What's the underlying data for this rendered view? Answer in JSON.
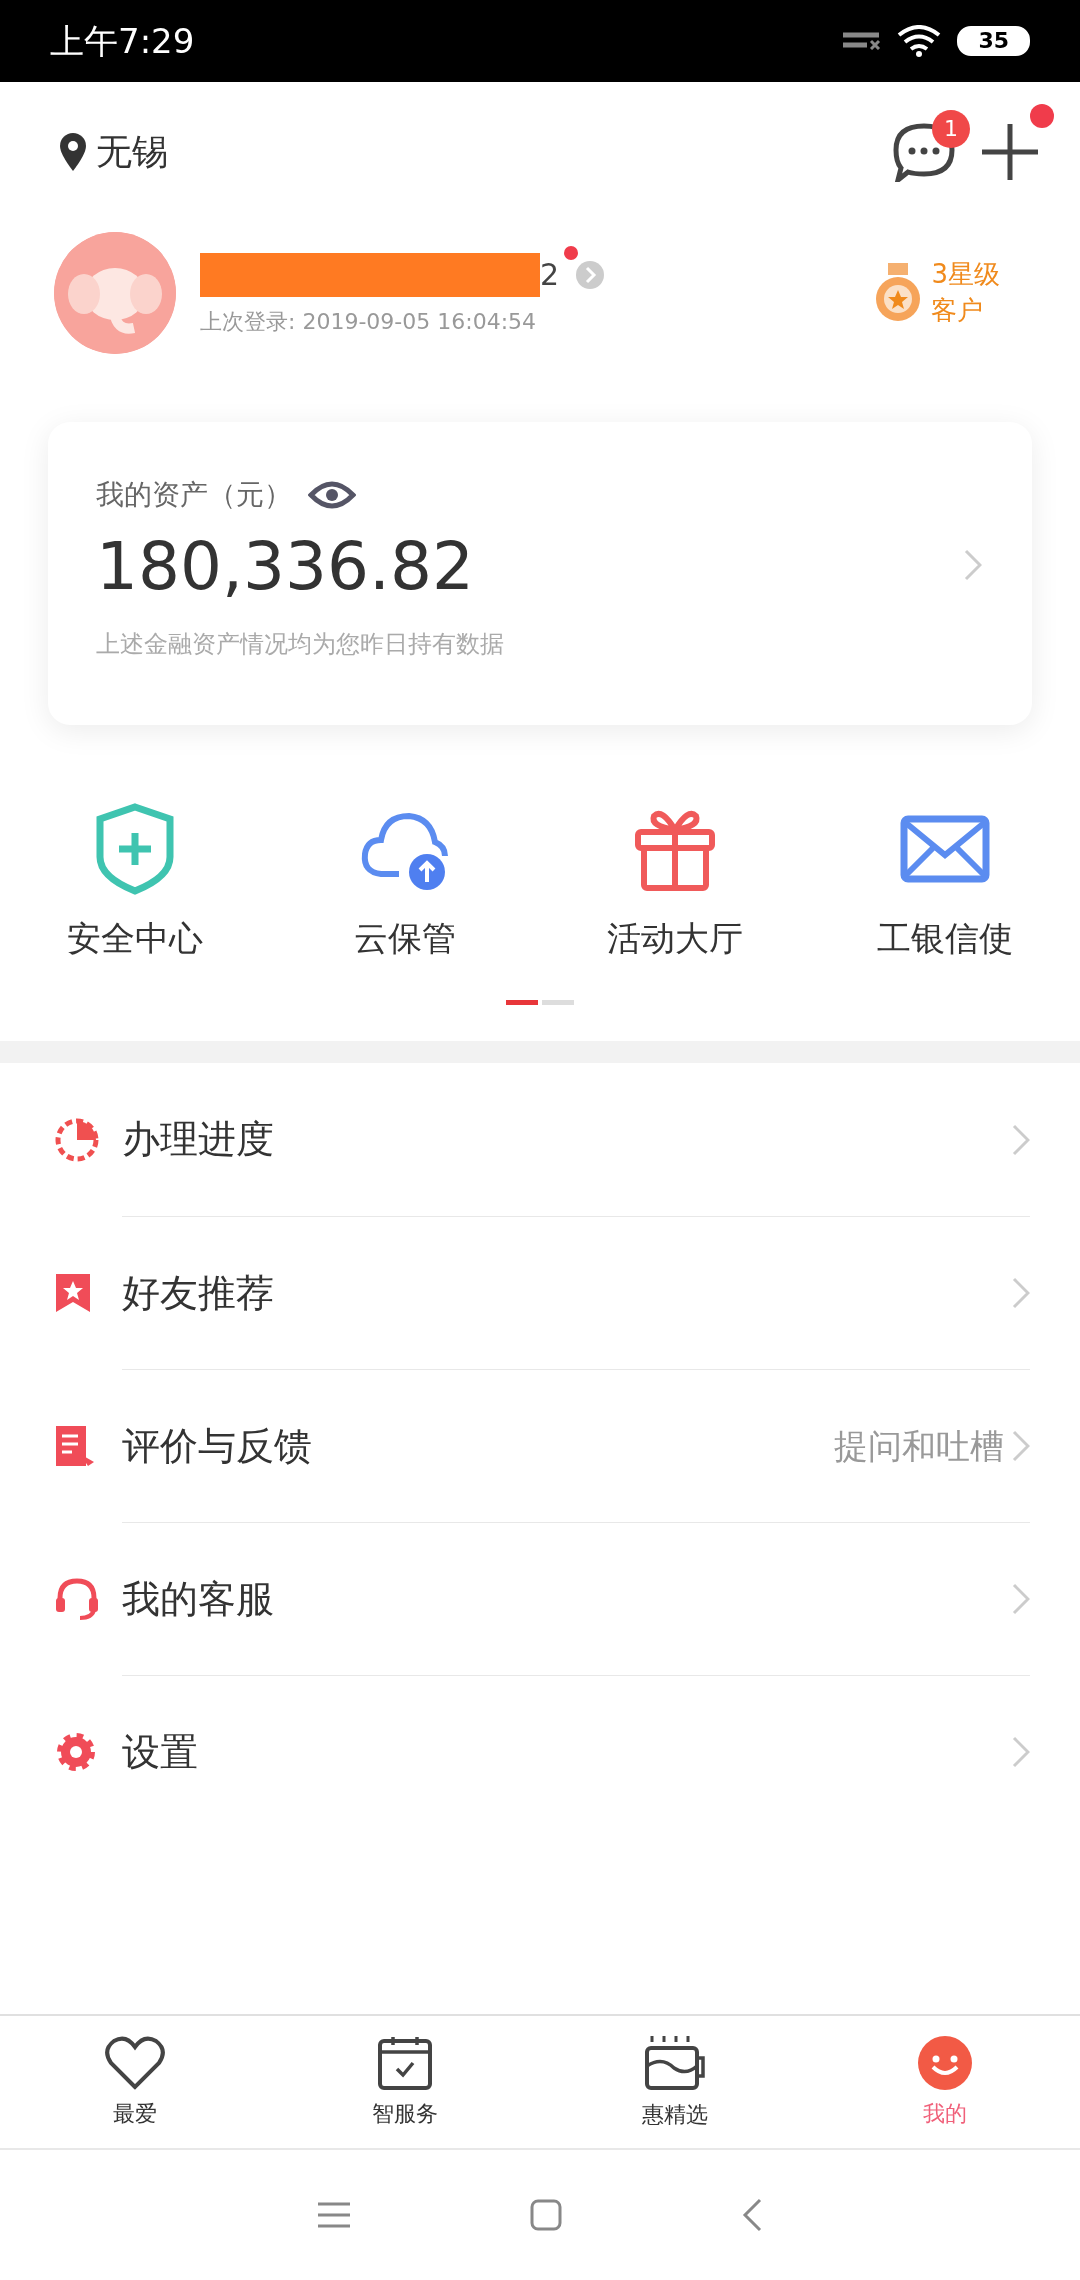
{
  "status_bar": {
    "time": "上午7:29",
    "battery": "35"
  },
  "header": {
    "location": "无锡",
    "message_badge": "1",
    "plus_dot": true
  },
  "profile": {
    "name_tail": "2",
    "last_login": "上次登录: 2019-09-05 16:04:54",
    "level": "3星级",
    "level_sub": "客户",
    "notice_dot": true
  },
  "assets": {
    "title": "我的资产（元）",
    "amount": "180,336.82",
    "note": "上述金融资产情况均为您昨日持有数据"
  },
  "shortcuts": [
    {
      "kind": "shield",
      "label": "安全中心"
    },
    {
      "kind": "cloud",
      "label": "云保管"
    },
    {
      "kind": "gift",
      "label": "活动大厅"
    },
    {
      "kind": "mail",
      "label": "工银信使"
    }
  ],
  "pages": [
    {
      "selected": true
    },
    {
      "selected": false
    }
  ],
  "menu": [
    {
      "kind": "progress",
      "label": "办理进度"
    },
    {
      "kind": "bookmark",
      "label": "好友推荐"
    },
    {
      "kind": "feedback",
      "label": "评价与反馈",
      "hint": "提问和吐槽"
    },
    {
      "kind": "service",
      "label": "我的客服"
    },
    {
      "kind": "settings",
      "label": "设置"
    }
  ],
  "tabs": [
    {
      "kind": "heart",
      "label": "最爱",
      "selected": false
    },
    {
      "kind": "calendar",
      "label": "智服务",
      "selected": false
    },
    {
      "kind": "cup",
      "label": "惠精选",
      "selected": false
    },
    {
      "kind": "smile",
      "label": "我的",
      "selected": true
    }
  ]
}
